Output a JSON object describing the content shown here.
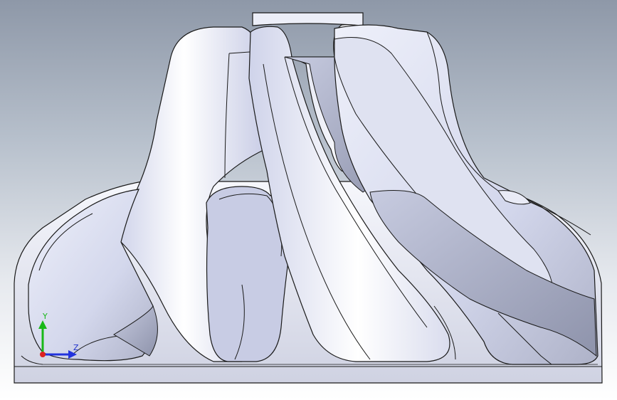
{
  "viewport": {
    "background_top": "#8e98a8",
    "background_bottom": "#ffffff"
  },
  "model": {
    "fill_light": "#f4f5fb",
    "fill_mid": "#d8dcef",
    "fill_shadow": "#a9adc4",
    "edge": "#1a1a1a"
  },
  "triad": {
    "x_label": "",
    "y_label": "Y",
    "z_label": "Z",
    "y_color": "#18b818",
    "z_color": "#2233dd",
    "x_color": "#dd2222"
  }
}
